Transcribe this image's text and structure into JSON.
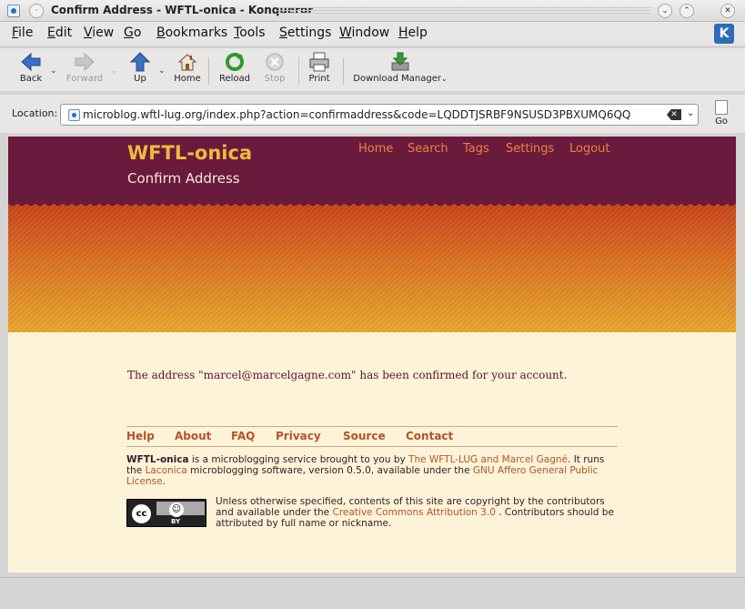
{
  "window": {
    "title": "Confirm Address - WFTL-onica - Konqueror"
  },
  "menu": {
    "items": [
      "File",
      "Edit",
      "View",
      "Go",
      "Bookmarks",
      "Tools",
      "Settings",
      "Window",
      "Help"
    ]
  },
  "toolbar": {
    "back": "Back",
    "forward": "Forward",
    "up": "Up",
    "home": "Home",
    "reload": "Reload",
    "stop": "Stop",
    "print": "Print",
    "download_manager": "Download Manager"
  },
  "location": {
    "label": "Location:",
    "url": "microblog.wftl-lug.org/index.php?action=confirmaddress&code=LQDDTJSRBF9NSUSD3PBXUMQ6QQ",
    "go": "Go"
  },
  "site": {
    "name": "WFTL-onica",
    "page_title": "Confirm Address",
    "nav": [
      "Home",
      "Search",
      "Tags",
      "Settings",
      "Logout"
    ]
  },
  "content": {
    "message": "The address \"marcel@marcelgagne.com\" has been confirmed for your account."
  },
  "footer": {
    "nav": [
      "Help",
      "About",
      "FAQ",
      "Privacy",
      "Source",
      "Contact"
    ],
    "about": {
      "brand": "WFTL-onica",
      "t1": " is a microblogging service brought to you by ",
      "link1": "The WFTL-LUG and Marcel Gagné",
      "t2": ". It runs the ",
      "link2": "Laconica",
      "t3": " microblogging software, version 0.5.0, available under the ",
      "link3": "GNU Affero General Public License",
      "t4": "."
    },
    "license": {
      "badge_cc": "cc",
      "badge_by": "BY",
      "t1": "Unless otherwise specified, contents of this site are copyright by the contributors and available under the ",
      "link": "Creative Commons Attribution 3.0",
      "t2": " . Contributors should be attributed by full name or nickname."
    }
  },
  "colors": {
    "header_bg": "#6a1a3d",
    "site_name": "#f2b83a",
    "nav_link": "#e9843a",
    "page_bg": "#fdf3d8",
    "footer_link": "#b4542a"
  }
}
